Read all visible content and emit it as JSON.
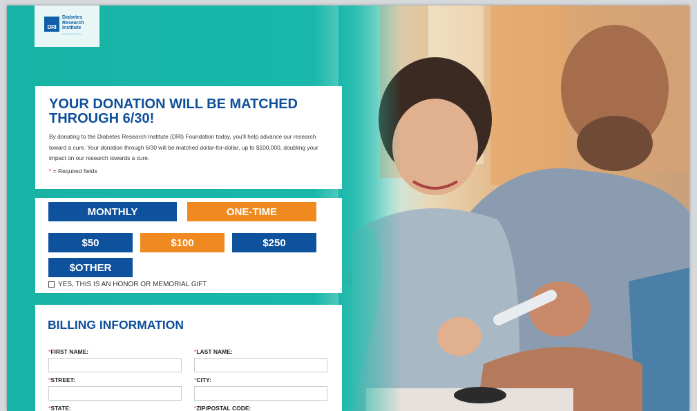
{
  "logo": {
    "mark": "DRI",
    "name": "Diabetes Research Institute",
    "tagline": "FOUNDATION"
  },
  "intro": {
    "headline": "YOUR DONATION WILL BE MATCHED THROUGH 6/30!",
    "body": "By donating to the Diabetes Research Institute (DRI) Foundation today, you'll help advance our research toward a cure. Your donation through 6/30 will be matched dollar-for-dollar, up to $100,000, doubling your impact on our research towards a cure.",
    "required_star": "*",
    "required_text": " = Required fields"
  },
  "gift": {
    "frequency": [
      {
        "label": "MONTHLY",
        "color": "#0e519c"
      },
      {
        "label": "ONE-TIME",
        "color": "#f08a20",
        "selected": true
      }
    ],
    "amounts": [
      {
        "label": "$50",
        "color": "#0e519c"
      },
      {
        "label": "$100",
        "color": "#f08a20",
        "selected": true
      },
      {
        "label": "$250",
        "color": "#0e519c"
      },
      {
        "label": "$OTHER",
        "color": "#0e519c"
      }
    ],
    "honor_label": "YES, THIS IS AN HONOR OR MEMORIAL GIFT",
    "honor_checked": false
  },
  "billing": {
    "title": "BILLING INFORMATION",
    "fields": {
      "first_name": {
        "label": "FIRST NAME:",
        "value": ""
      },
      "last_name": {
        "label": "LAST NAME:",
        "value": ""
      },
      "street": {
        "label": "STREET:",
        "value": ""
      },
      "city": {
        "label": "CITY:",
        "value": ""
      },
      "state": {
        "label": "STATE:",
        "value": ""
      },
      "zip": {
        "label": "ZIP/POSTAL CODE:",
        "value": ""
      }
    }
  },
  "colors": {
    "brand_blue": "#0e519c",
    "brand_orange": "#f08a20",
    "teal_background": "#17b3a6",
    "required_red": "#ee1144"
  }
}
